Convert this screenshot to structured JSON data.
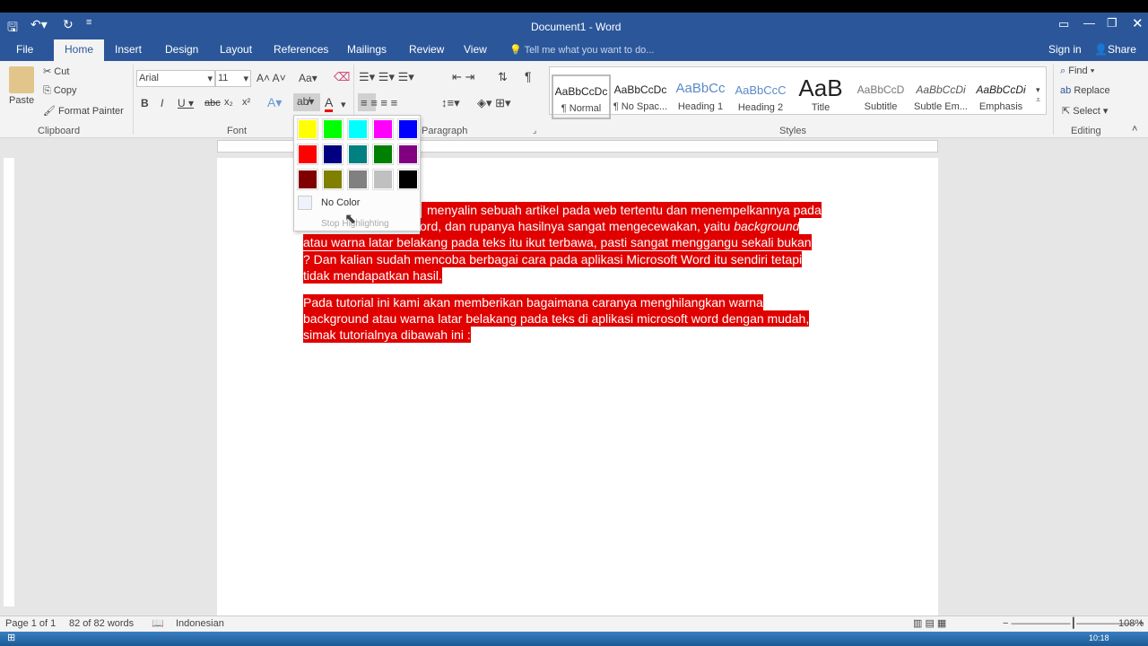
{
  "window": {
    "title": "Document1 - Word",
    "sign_in": "Sign in",
    "share": "Share"
  },
  "tabs": [
    "File",
    "Home",
    "Insert",
    "Design",
    "Layout",
    "References",
    "Mailings",
    "Review",
    "View"
  ],
  "tell_me": "Tell me what you want to do...",
  "clipboard": {
    "paste": "Paste",
    "cut": "Cut",
    "copy": "Copy",
    "format_painter": "Format Painter",
    "label": "Clipboard"
  },
  "font": {
    "name": "Arial",
    "size": "11",
    "label": "Font",
    "case": "Aa"
  },
  "paragraph": {
    "label": "Paragraph"
  },
  "styles": {
    "label": "Styles",
    "items": [
      {
        "preview": "AaBbCcDc",
        "name": "¶ Normal"
      },
      {
        "preview": "AaBbCcDc",
        "name": "¶ No Spac..."
      },
      {
        "preview": "AaBbCc",
        "name": "Heading 1"
      },
      {
        "preview": "AaBbCcC",
        "name": "Heading 2"
      },
      {
        "preview": "AaB",
        "name": "Title"
      },
      {
        "preview": "AaBbCcD",
        "name": "Subtitle"
      },
      {
        "preview": "AaBbCcDi",
        "name": "Subtle Em..."
      },
      {
        "preview": "AaBbCcDi",
        "name": "Emphasis"
      }
    ]
  },
  "editing": {
    "find": "Find",
    "replace": "Replace",
    "select": "Select",
    "label": "Editing"
  },
  "highlight_menu": {
    "colors": [
      "#ffff00",
      "#00ff00",
      "#00ffff",
      "#ff00ff",
      "#0000ff",
      "#ff0000",
      "#000080",
      "#008080",
      "#008000",
      "#800080",
      "#800000",
      "#808000",
      "#808080",
      "#c0c0c0",
      "#000000"
    ],
    "no_color": "No Color",
    "stop": "Stop Highlighting"
  },
  "document": {
    "lines": [
      "menyalin sebuah artikel pada web tertentu dan menempelkannya pada",
      "ord, dan rupanya hasilnya sangat mengecewakan, yaitu ",
      "atau warna latar belakang pada teks itu ikut terbawa, pasti sangat menggangu sekali bukan",
      "? Dan kalian sudah mencoba berbagai cara pada aplikasi Microsoft Word itu sendiri tetapi",
      "tidak mendapatkan hasil.",
      "Pada tutorial ini kami akan memberikan bagaimana caranya menghilangkan warna",
      "background atau warna latar belakang pada teks di aplikasi microsoft word dengan mudah,",
      "simak tutorialnya dibawah ini :"
    ],
    "italic_word": "background",
    "highlight_color": "#e00000"
  },
  "status": {
    "page": "Page 1 of 1",
    "words": "82 of 82 words",
    "language": "Indonesian",
    "zoom": "108%"
  },
  "taskbar": {
    "time": "10:18"
  }
}
